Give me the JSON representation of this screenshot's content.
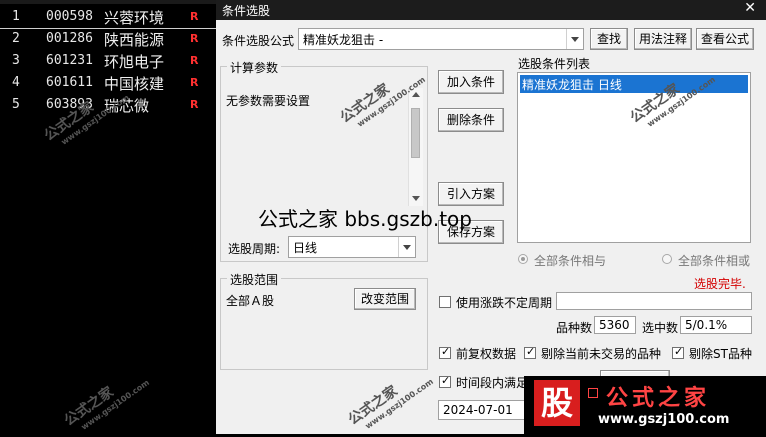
{
  "stocks": [
    {
      "idx": "1",
      "code": "000598",
      "name": "兴蓉环境",
      "flag": "R"
    },
    {
      "idx": "2",
      "code": "001286",
      "name": "陕西能源",
      "flag": "R"
    },
    {
      "idx": "3",
      "code": "601231",
      "name": "环旭电子",
      "flag": "R"
    },
    {
      "idx": "4",
      "code": "601611",
      "name": "中国核建",
      "flag": "R"
    },
    {
      "idx": "5",
      "code": "603893",
      "name": "瑞芯微",
      "flag": "R"
    }
  ],
  "dialog": {
    "title": "条件选股",
    "close": "✕",
    "formula_label": "条件选股公式",
    "formula_value": "精准妖龙狙击 -",
    "find_button": "查找",
    "usage_button": "用法注释",
    "view_button": "查看公式",
    "calc_group": "计算参数",
    "no_params": "无参数需要设置",
    "period_label": "选股周期:",
    "period_value": "日线",
    "add_button": "加入条件",
    "delete_button": "删除条件",
    "import_button": "引入方案",
    "save_button": "保存方案",
    "cond_list_label": "选股条件列表",
    "cond_item": "精准妖龙狙击  日线",
    "radio_and": "全部条件相与",
    "radio_or": "全部条件相或",
    "status": "选股完毕.",
    "range_group": "选股范围",
    "range_value": "全部Ａ股",
    "range_button": "改变范围",
    "use_period": "使用涨跌不定周期",
    "count_label": "品种数",
    "count_value": "5360",
    "selected_label": "选中数",
    "selected_value": "5/0.1%",
    "opt_adjust": "前复权数据",
    "opt_untraded": "剔除当前未交易的品种",
    "opt_st": "剔除ST品种",
    "opt_period": "时间段内满足",
    "date_value": "2024-07-01"
  },
  "overlay": {
    "banner": "公式之家 bbs.gszb.top",
    "wm_title": "公式之家",
    "wm_url": "www.gszj100.com",
    "logo_char": "股",
    "logo_name": "公式之家",
    "logo_url": "www.gszj100.com"
  },
  "colors": {
    "selection": "#1b74d2",
    "status": "#d40000",
    "logo_red": "#d81e1e"
  }
}
